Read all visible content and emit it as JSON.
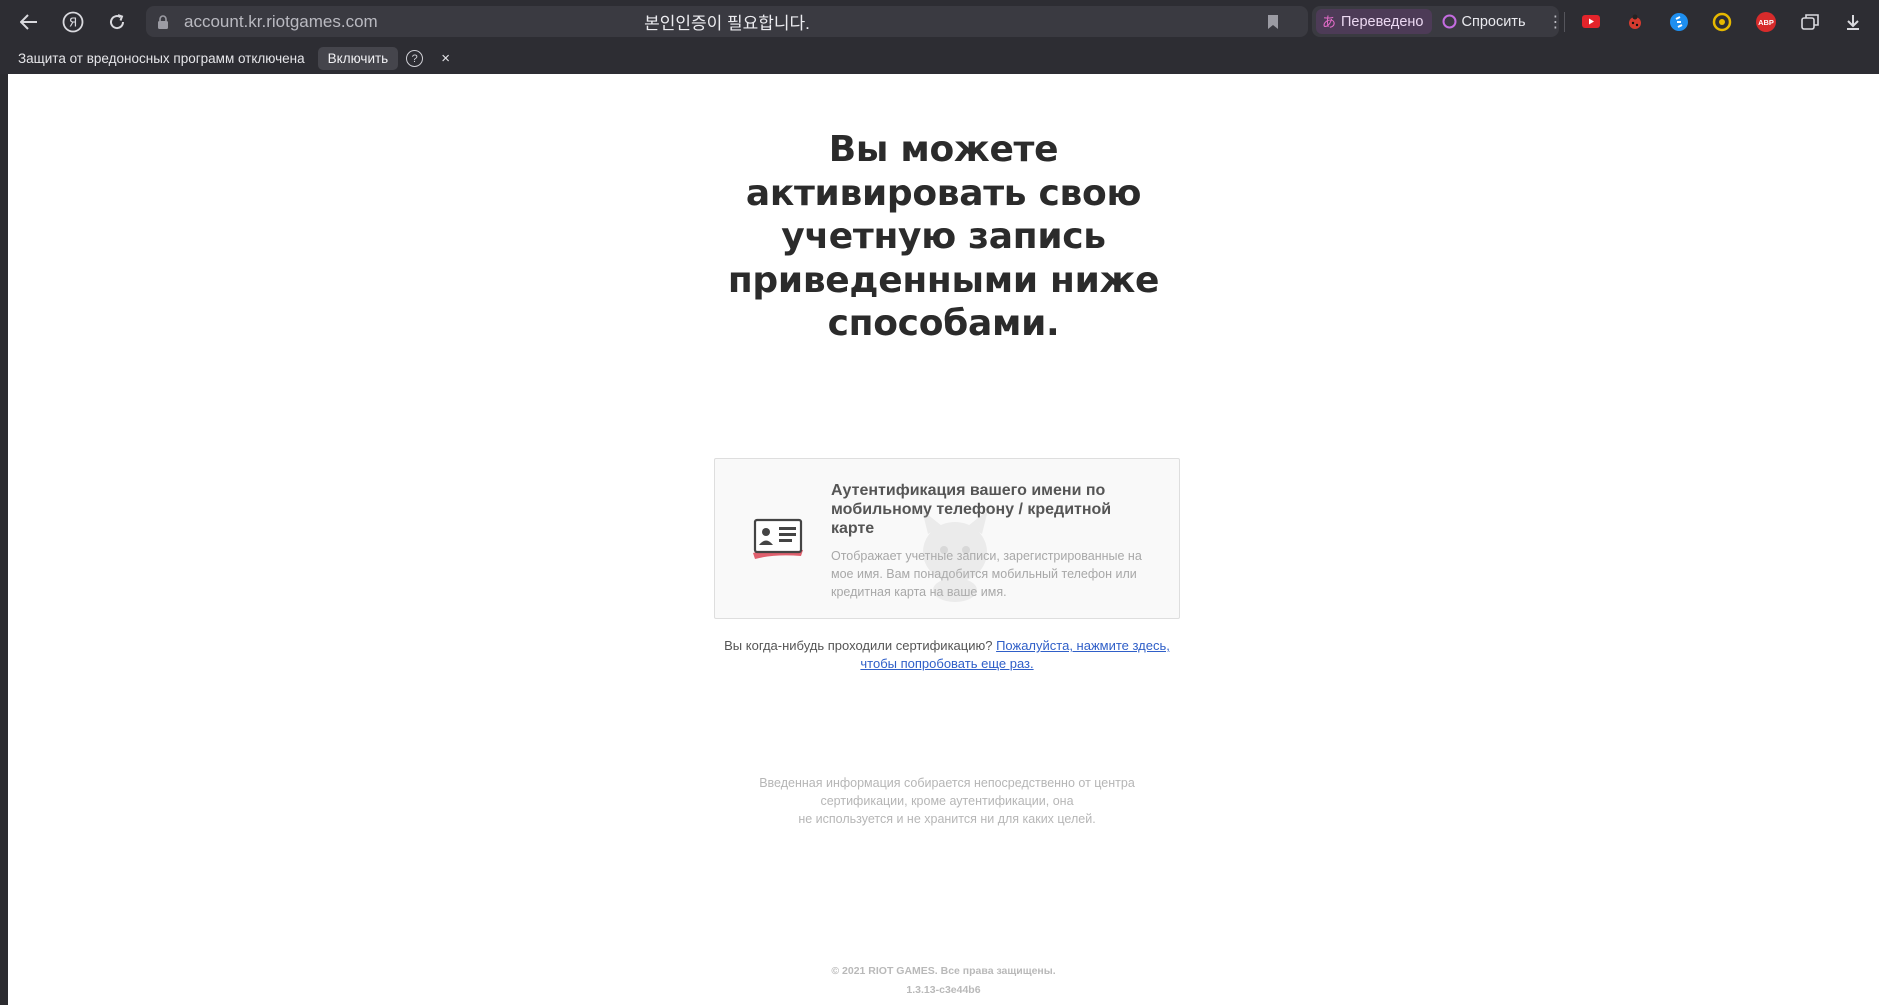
{
  "browser": {
    "url": "account.kr.riotgames.com",
    "tab_title": "본인인증이 필요합니다.",
    "translated_label": "Переведено",
    "ask_label": "Спросить",
    "infobar": {
      "text": "Защита от вредоносных программ отключена",
      "button_label": "Включить",
      "help_glyph": "?",
      "close_glyph": "×"
    },
    "extensions": [
      "youtube-icon",
      "ladybug-icon",
      "shazam-icon",
      "coin-icon",
      "adblock-icon",
      "collections-icon",
      "download-icon"
    ],
    "adblock_label": "ABP"
  },
  "page": {
    "heading_lines": [
      "Вы можете",
      "активировать свою",
      "учетную запись",
      "приведенными ниже",
      "способами."
    ],
    "card": {
      "title_lines": [
        "Аутентификация вашего имени по",
        "мобильному телефону / кредитной",
        "карте"
      ],
      "description_lines": [
        "Отображает учетные записи, зарегистрированные на",
        "мое имя. Вам понадобится мобильный телефон или",
        "кредитная карта на ваше имя."
      ]
    },
    "retry_text": "Вы когда-нибудь проходили сертификацию?",
    "retry_link_line1": "Пожалуйста, нажмите здесь,",
    "retry_link_line2": "чтобы попробовать еще раз.",
    "note_lines": [
      "Введенная информация собирается непосредственно от центра",
      "сертификации, кроме аутентификации, она",
      "не используется и не хранится ни для каких целей."
    ],
    "footer_copyright": "© 2021 RIOT GAMES. Все права защищены.",
    "footer_version": "1.3.13-c3e44b6"
  },
  "colors": {
    "chrome_bg": "#2d2d33",
    "translated_pill": "#4d3b57",
    "link": "#2f5fc8",
    "card_icon_accent": "#e0606e"
  }
}
